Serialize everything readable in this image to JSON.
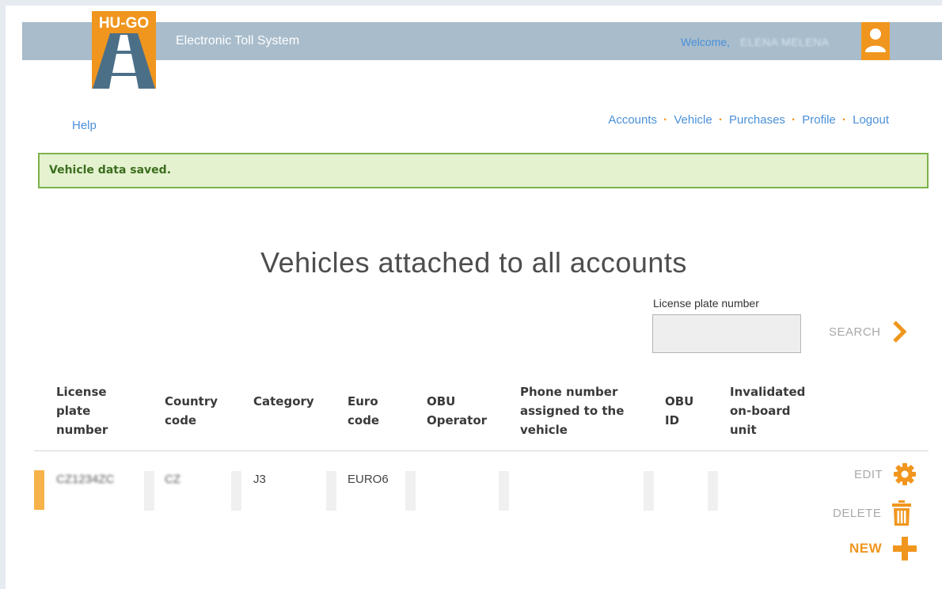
{
  "header": {
    "logo_text": "HU-GO",
    "app_title": "Electronic Toll System",
    "welcome": "Welcome,",
    "user_name": "ELENA MELENA"
  },
  "nav": {
    "help": "Help",
    "links": [
      "Accounts",
      "Vehicle",
      "Purchases",
      "Profile",
      "Logout"
    ]
  },
  "alert": {
    "message": "Vehicle data saved."
  },
  "page_title": "Vehicles attached to all accounts",
  "search": {
    "label": "License plate number",
    "value": "",
    "button": "SEARCH"
  },
  "table": {
    "columns": [
      [
        "License",
        "plate",
        "number"
      ],
      [
        "Country",
        "code"
      ],
      [
        "Category"
      ],
      [
        "Euro",
        "code"
      ],
      [
        "OBU",
        "Operator"
      ],
      [
        "Phone number",
        "assigned to the",
        "vehicle"
      ],
      [
        "OBU",
        "ID"
      ],
      [
        "Invalidated",
        "on-board",
        "unit"
      ]
    ],
    "rows": [
      {
        "license_plate": "CZ1234ZC",
        "country_code": "CZ",
        "category": "J3",
        "euro_code": "EURO6",
        "obu_operator": "",
        "phone": "",
        "obu_id": "",
        "invalidated": ""
      }
    ]
  },
  "actions": {
    "edit": "EDIT",
    "delete": "DELETE",
    "new": "NEW"
  },
  "colors": {
    "accent": "#f0961e",
    "link": "#4a90d9",
    "header_bar": "#a8bccb",
    "alert_bg": "#e4f2cf",
    "alert_border": "#7cb24a",
    "row_marker": "#f7b24a"
  },
  "icons": {
    "search": "chevron-right-icon",
    "edit": "gear-icon",
    "delete": "trash-icon",
    "new": "plus-icon",
    "user": "user-icon"
  }
}
